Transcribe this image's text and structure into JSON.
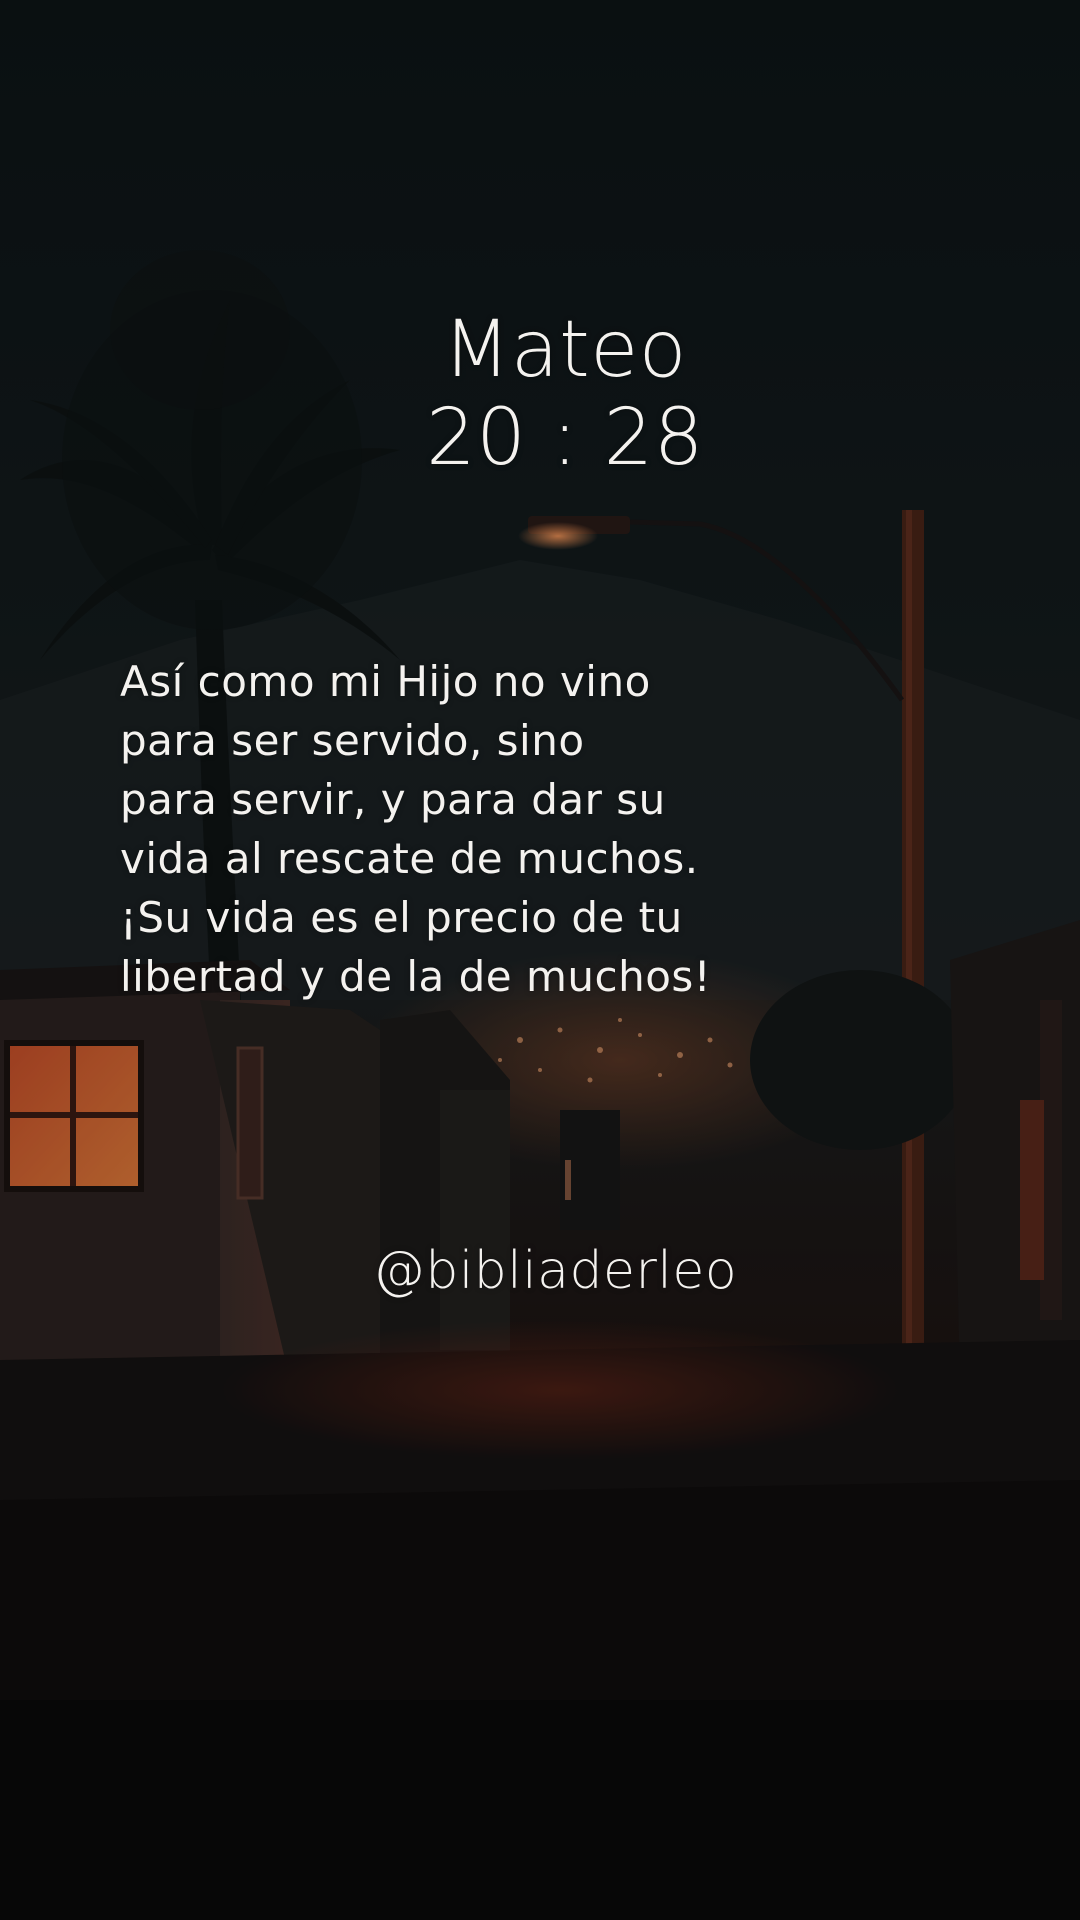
{
  "reference": {
    "book": "Mateo",
    "chapter_verse": "20 : 28"
  },
  "verse_lines": [
    "Así como mi Hijo no vino",
    "para ser servido, sino",
    "para servir, y para dar su",
    "vida al rescate de muchos.",
    "¡Su vida es el precio de tu",
    "libertad y de la de muchos!"
  ],
  "handle": "@bibliaderleo",
  "colors": {
    "text": "#f4f2ef",
    "sky": "#0e1517",
    "window_glow": "#c8502a",
    "street_glow": "#7a2a18"
  },
  "icons": [
    "palm-tree",
    "street-lamp",
    "house-with-lit-window"
  ]
}
